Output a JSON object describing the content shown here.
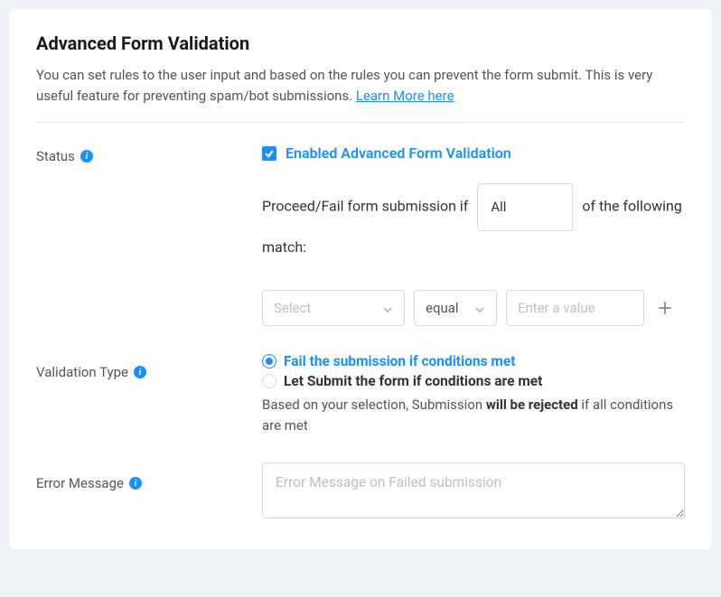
{
  "header": {
    "title": "Advanced Form Validation",
    "description_pre": "You can set rules to the user input and based on the rules you can prevent the form submit. This is very useful feature for preventing spam/bot submissions. ",
    "learn_more": "Learn More here"
  },
  "status": {
    "label": "Status",
    "checkbox_label": "Enabled Advanced Form Validation",
    "sentence_pre": "Proceed/Fail form submission if",
    "scope_select": "All",
    "sentence_post": " of the following match:",
    "condition": {
      "field_placeholder": "Select",
      "operator": "equal",
      "value_placeholder": "Enter a value"
    }
  },
  "validation_type": {
    "label": "Validation Type",
    "opt1": "Fail the submission if conditions met",
    "opt2": "Let Submit the form if conditions are met",
    "hint_pre": "Based on your selection, Submission ",
    "hint_strong": "will be rejected",
    "hint_post": " if all conditions are met"
  },
  "error_message": {
    "label": "Error Message",
    "placeholder": "Error Message on Failed submission"
  },
  "icons": {
    "info": "i"
  }
}
